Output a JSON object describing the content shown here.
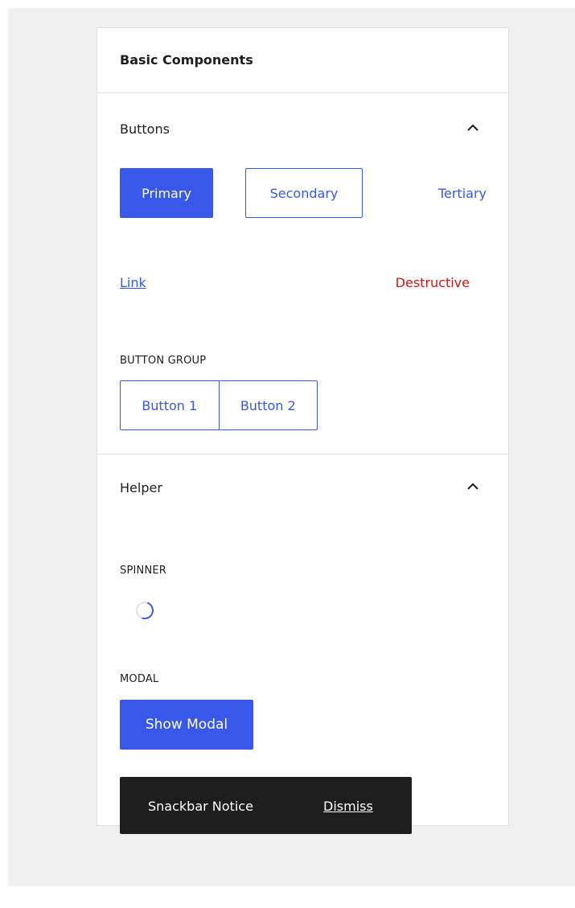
{
  "panel": {
    "title": "Basic Components"
  },
  "buttons_section": {
    "title": "Buttons",
    "toggle_icon": "chevron-up-icon",
    "primary_label": "Primary",
    "secondary_label": "Secondary",
    "tertiary_label": "Tertiary",
    "link_label": "Link",
    "destructive_label": "Destructive",
    "button_group": {
      "label": "BUTTON GROUP",
      "buttons": [
        "Button 1",
        "Button 2"
      ]
    }
  },
  "helper_section": {
    "title": "Helper",
    "toggle_icon": "chevron-up-icon",
    "spinner_label": "SPINNER",
    "modal_label": "MODAL",
    "show_modal_label": "Show Modal",
    "snackbar": {
      "text": "Snackbar Notice",
      "action": "Dismiss"
    }
  },
  "colors": {
    "accent": "#3858e9",
    "destructive": "#cc1818",
    "snackbar_bg": "#1e1e1e",
    "border": "#e0e0e0",
    "page_bg": "#f0f0f0"
  }
}
